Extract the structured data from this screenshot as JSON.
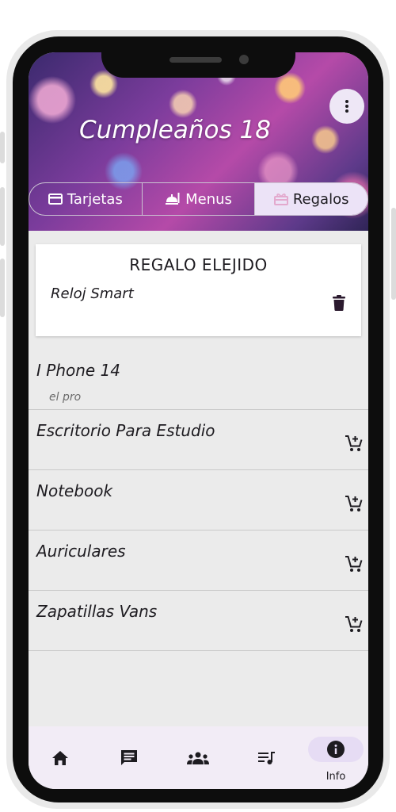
{
  "event": {
    "title": "Cumpleaños 18"
  },
  "tabs": [
    {
      "label": "Tarjetas",
      "icon": "card-icon",
      "active": false
    },
    {
      "label": "Menus",
      "icon": "food-icon",
      "active": false
    },
    {
      "label": "Regalos",
      "icon": "gift-icon",
      "active": true
    }
  ],
  "chosen_gift": {
    "heading": "REGALO ELEJIDO",
    "item": "Reloj Smart"
  },
  "gifts": [
    {
      "title": "I Phone 14",
      "subtitle": "el pro",
      "has_cart": false
    },
    {
      "title": "Escritorio Para Estudio",
      "subtitle": "",
      "has_cart": true
    },
    {
      "title": "Notebook",
      "subtitle": "",
      "has_cart": true
    },
    {
      "title": "Auriculares",
      "subtitle": "",
      "has_cart": true
    },
    {
      "title": "Zapatillas Vans",
      "subtitle": "",
      "has_cart": true
    }
  ],
  "bottom_nav": {
    "items": [
      "home-icon",
      "chat-icon",
      "guests-icon",
      "playlist-icon",
      "info-icon"
    ],
    "active_label": "Info"
  },
  "colors": {
    "accent_light": "#ece3f7",
    "nav_background": "#f2ecf6",
    "screen_background": "#ebebeb"
  }
}
